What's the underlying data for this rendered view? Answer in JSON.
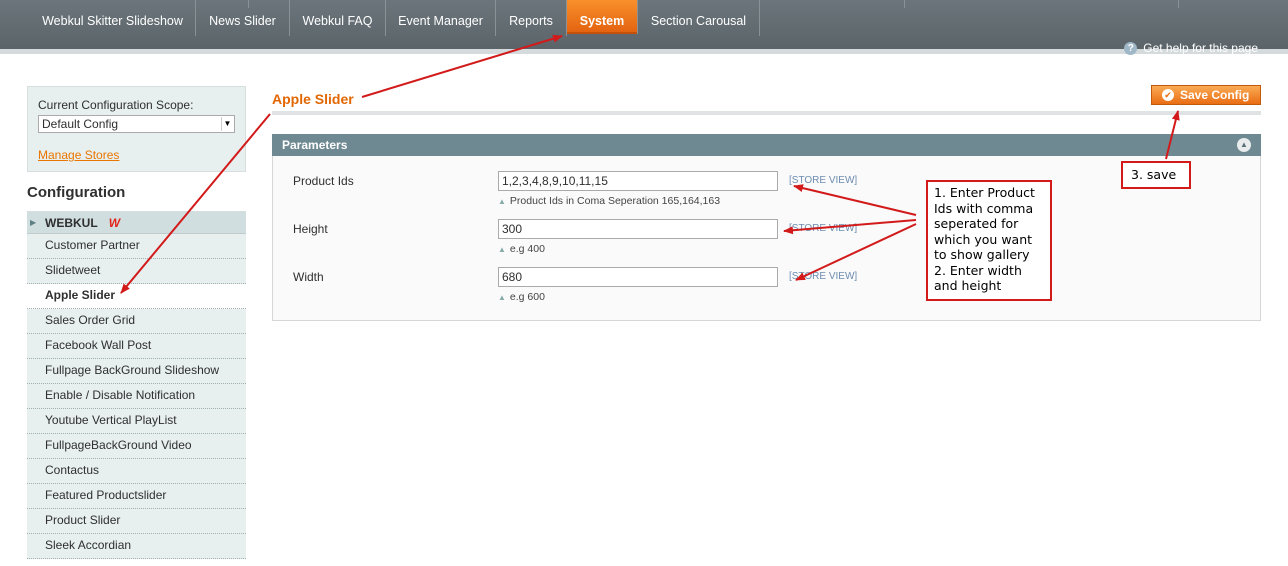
{
  "nav": {
    "items": [
      "Webkul Skitter Slideshow",
      "News Slider",
      "Webkul FAQ",
      "Event Manager",
      "Reports",
      "System",
      "Section Carousal"
    ],
    "active": "System",
    "help": "Get help for this page"
  },
  "sidebar": {
    "scope_label": "Current Configuration Scope:",
    "scope_value": "Default Config",
    "manage_stores": "Manage Stores",
    "config_title": "Configuration",
    "group_head": "WEBKUL",
    "group_logo": "W",
    "items": [
      "Customer Partner",
      "Slidetweet",
      "Apple Slider",
      "Sales Order Grid",
      "Facebook Wall Post",
      "Fullpage BackGround Slideshow",
      "Enable / Disable Notification",
      "Youtube Vertical PlayList",
      "FullpageBackGround Video",
      "Contactus",
      "Featured Productslider",
      "Product Slider",
      "Sleek Accordian"
    ],
    "active_item": "Apple Slider"
  },
  "main": {
    "title": "Apple Slider",
    "save_label": "Save Config",
    "fieldset_title": "Parameters",
    "fields": [
      {
        "label": "Product Ids",
        "value": "1,2,3,4,8,9,10,11,15",
        "scope": "[STORE VIEW]",
        "note": "Product Ids in Coma Seperation 165,164,163"
      },
      {
        "label": "Height",
        "value": "300",
        "scope": "[STORE VIEW]",
        "note": "e.g 400"
      },
      {
        "label": "Width",
        "value": "680",
        "scope": "[STORE VIEW]",
        "note": "e.g 600"
      }
    ]
  },
  "annotations": {
    "callout1_lines": [
      "1. Enter Product",
      "Ids with comma",
      "seperated for",
      "which you want",
      "to show gallery",
      "2. Enter width",
      "and height"
    ],
    "callout2": "3. save",
    "color": "#d21a1a"
  }
}
